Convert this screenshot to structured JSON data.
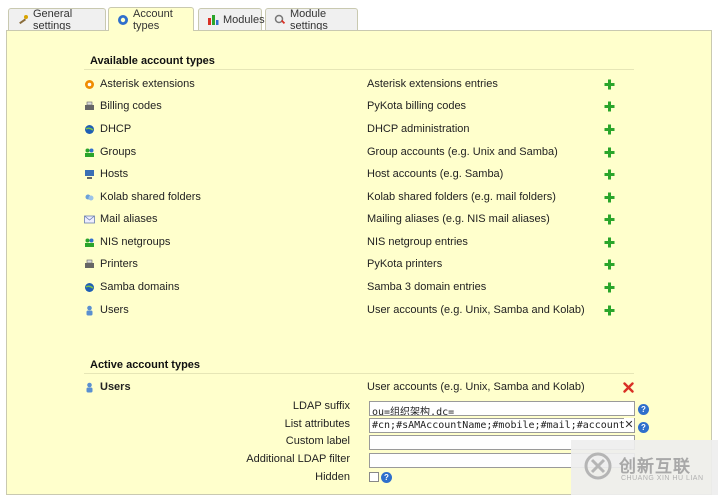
{
  "tabs": [
    {
      "label": "General settings",
      "icon": "tools-icon"
    },
    {
      "label": "Account types",
      "icon": "account-types-icon"
    },
    {
      "label": "Modules",
      "icon": "modules-icon"
    },
    {
      "label": "Module settings",
      "icon": "module-settings-icon"
    }
  ],
  "available": {
    "title": "Available account types",
    "items": [
      {
        "name": "Asterisk extensions",
        "desc": "Asterisk extensions entries",
        "icon": "asterisk-icon"
      },
      {
        "name": "Billing codes",
        "desc": "PyKota billing codes",
        "icon": "billing-icon"
      },
      {
        "name": "DHCP",
        "desc": "DHCP administration",
        "icon": "dhcp-icon"
      },
      {
        "name": "Groups",
        "desc": "Group accounts (e.g. Unix and Samba)",
        "icon": "groups-icon"
      },
      {
        "name": "Hosts",
        "desc": "Host accounts (e.g. Samba)",
        "icon": "hosts-icon"
      },
      {
        "name": "Kolab shared folders",
        "desc": "Kolab shared folders (e.g. mail folders)",
        "icon": "folders-icon"
      },
      {
        "name": "Mail aliases",
        "desc": "Mailing aliases (e.g. NIS mail aliases)",
        "icon": "mail-icon"
      },
      {
        "name": "NIS netgroups",
        "desc": "NIS netgroup entries",
        "icon": "netgroups-icon"
      },
      {
        "name": "Printers",
        "desc": "PyKota printers",
        "icon": "printer-icon"
      },
      {
        "name": "Samba domains",
        "desc": "Samba 3 domain entries",
        "icon": "domain-icon"
      },
      {
        "name": "Users",
        "desc": "User accounts (e.g. Unix, Samba and Kolab)",
        "icon": "user-icon"
      }
    ]
  },
  "active": {
    "title": "Active account types",
    "item": {
      "name": "Users",
      "desc": "User accounts (e.g. Unix, Samba and Kolab)"
    },
    "fields": {
      "ldap_suffix_label": "LDAP suffix",
      "ldap_suffix_value": "ou=组织架构,dc=",
      "list_attributes_label": "List attributes",
      "list_attributes_value": "#cn;#sAMAccountName;#mobile;#mail;#accountExpir",
      "custom_label_label": "Custom label",
      "custom_label_value": "",
      "additional_filter_label": "Additional LDAP filter",
      "additional_filter_value": "",
      "hidden_label": "Hidden"
    }
  },
  "watermark": {
    "text": "创新互联",
    "subtext": "CHUANG XIN HU LIAN"
  },
  "colors": {
    "panel_bg": "#ffffcc",
    "plus": "#2aa52a",
    "delete": "#d93025",
    "help": "#2f6fcc"
  }
}
